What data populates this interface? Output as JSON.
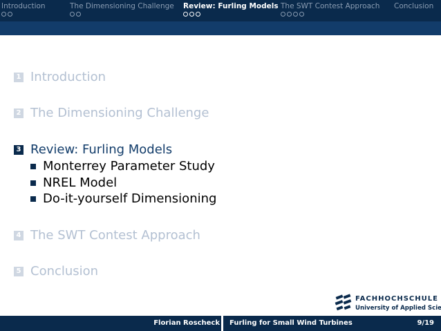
{
  "nav": {
    "items": [
      {
        "label": "Introduction",
        "dots": 2
      },
      {
        "label": "The Dimensioning Challenge",
        "dots": 2
      },
      {
        "label": "Review: Furling Models",
        "dots": 3
      },
      {
        "label": "The SWT Contest Approach",
        "dots": 4
      },
      {
        "label": "Conclusion",
        "dots": 0
      }
    ],
    "active_index": 2
  },
  "toc": {
    "sections": [
      {
        "number": "1",
        "title": "Introduction",
        "state": "faded"
      },
      {
        "number": "2",
        "title": "The Dimensioning Challenge",
        "state": "faded"
      },
      {
        "number": "3",
        "title": "Review: Furling Models",
        "state": "current",
        "subsections": [
          "Monterrey Parameter Study",
          "NREL Model",
          "Do-it-yourself Dimensioning"
        ]
      },
      {
        "number": "4",
        "title": "The SWT Contest Approach",
        "state": "faded"
      },
      {
        "number": "5",
        "title": "Conclusion",
        "state": "faded"
      }
    ]
  },
  "logo": {
    "name": "FACHHOCHSCHULE KIEL",
    "subtitle": "University of Applied Sciences",
    "icon": "fh-kiel-logo-icon"
  },
  "footer": {
    "author": "Florian Roscheck",
    "title": "Furling for Small Wind Turbines",
    "page": "9/19"
  },
  "colors": {
    "nav_bg": "#0a2a4c",
    "subbar_bg": "#123c6a",
    "faded_text": "#b3c0d2",
    "accent": "#123c6a"
  }
}
